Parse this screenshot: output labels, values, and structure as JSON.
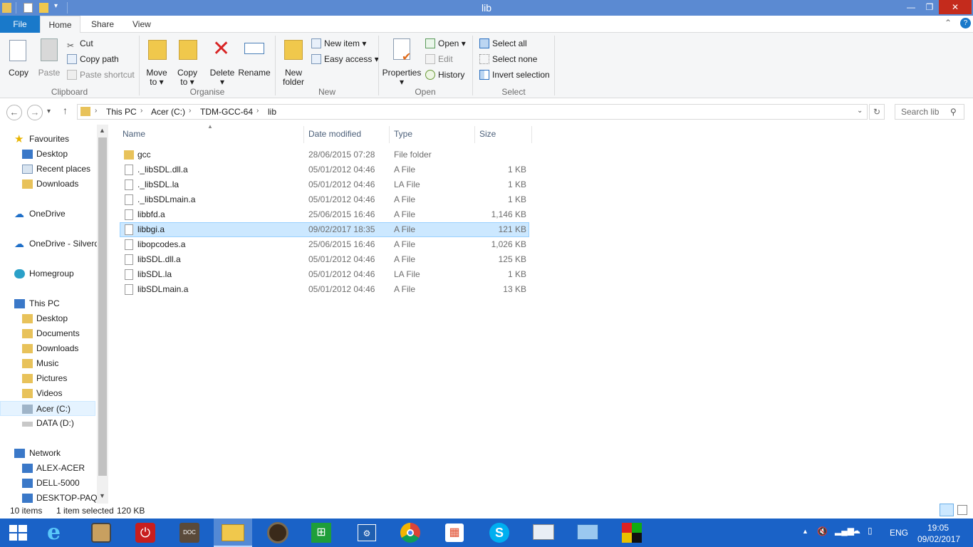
{
  "window": {
    "title": "lib"
  },
  "tabs": {
    "file": "File",
    "home": "Home",
    "share": "Share",
    "view": "View"
  },
  "ribbon": {
    "clipboard": {
      "copy": "Copy",
      "paste": "Paste",
      "cut": "Cut",
      "copy_path": "Copy path",
      "paste_shortcut": "Paste shortcut",
      "label": "Clipboard"
    },
    "organise": {
      "move_to_1": "Move",
      "move_to_2": "to",
      "copy_to_1": "Copy",
      "copy_to_2": "to",
      "delete": "Delete",
      "rename": "Rename",
      "label": "Organise"
    },
    "new": {
      "new_folder_1": "New",
      "new_folder_2": "folder",
      "new_item": "New item",
      "easy_access": "Easy access",
      "label": "New"
    },
    "open": {
      "properties": "Properties",
      "open": "Open",
      "edit": "Edit",
      "history": "History",
      "label": "Open"
    },
    "select": {
      "select_all": "Select all",
      "select_none": "Select none",
      "invert": "Invert selection",
      "label": "Select"
    }
  },
  "address": {
    "crumbs": [
      "This PC",
      "Acer (C:)",
      "TDM-GCC-64",
      "lib"
    ],
    "search_placeholder": "Search lib"
  },
  "nav": {
    "favourites": "Favourites",
    "fav_items": [
      "Desktop",
      "Recent places",
      "Downloads"
    ],
    "onedrive": "OneDrive",
    "onedrive2": "OneDrive - Silverdale",
    "homegroup": "Homegroup",
    "thispc": "This PC",
    "pc_items": [
      "Desktop",
      "Documents",
      "Downloads",
      "Music",
      "Pictures",
      "Videos",
      "Acer (C:)",
      "DATA (D:)"
    ],
    "network": "Network",
    "net_items": [
      "ALEX-ACER",
      "DELL-5000",
      "DESKTOP-PAQM"
    ]
  },
  "columns": {
    "name": "Name",
    "date": "Date modified",
    "type": "Type",
    "size": "Size"
  },
  "files": [
    {
      "name": "gcc",
      "date": "28/06/2015 07:28",
      "type": "File folder",
      "size": ""
    },
    {
      "name": "._libSDL.dll.a",
      "date": "05/01/2012 04:46",
      "type": "A File",
      "size": "1 KB"
    },
    {
      "name": "._libSDL.la",
      "date": "05/01/2012 04:46",
      "type": "LA File",
      "size": "1 KB"
    },
    {
      "name": "._libSDLmain.a",
      "date": "05/01/2012 04:46",
      "type": "A File",
      "size": "1 KB"
    },
    {
      "name": "libbfd.a",
      "date": "25/06/2015 16:46",
      "type": "A File",
      "size": "1,146 KB"
    },
    {
      "name": "libbgi.a",
      "date": "09/02/2017 18:35",
      "type": "A File",
      "size": "121 KB"
    },
    {
      "name": "libopcodes.a",
      "date": "25/06/2015 16:46",
      "type": "A File",
      "size": "1,026 KB"
    },
    {
      "name": "libSDL.dll.a",
      "date": "05/01/2012 04:46",
      "type": "A File",
      "size": "125 KB"
    },
    {
      "name": "libSDL.la",
      "date": "05/01/2012 04:46",
      "type": "LA File",
      "size": "1 KB"
    },
    {
      "name": "libSDLmain.a",
      "date": "05/01/2012 04:46",
      "type": "A File",
      "size": "13 KB"
    }
  ],
  "status": {
    "count": "10 items",
    "selected": "1 item selected",
    "size": "120 KB"
  },
  "tray": {
    "lang": "ENG",
    "time": "19:05",
    "date": "09/02/2017"
  }
}
